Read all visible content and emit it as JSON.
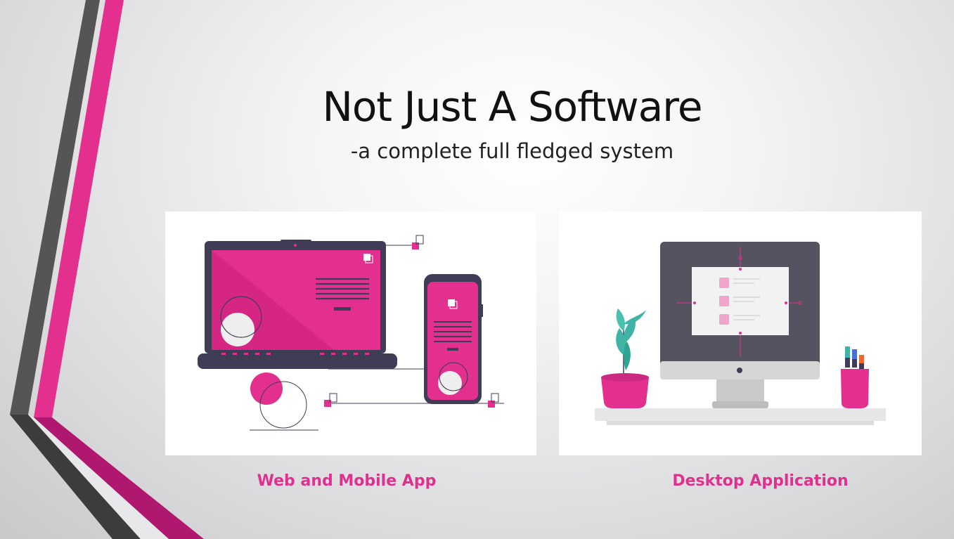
{
  "slide": {
    "title": "Not Just A Software",
    "subtitle": "-a complete full fledged system"
  },
  "cards": [
    {
      "caption": "Web and Mobile App",
      "illustration": "laptop-and-phone"
    },
    {
      "caption": "Desktop Application",
      "illustration": "desktop-monitor-with-plant-and-pens"
    }
  ],
  "colors": {
    "accent": "#e3308f",
    "dark": "#3f3d56",
    "gray_stripe": "#5a5a5a",
    "caption": "#e0308f",
    "leaf": "#3fb4a6"
  }
}
